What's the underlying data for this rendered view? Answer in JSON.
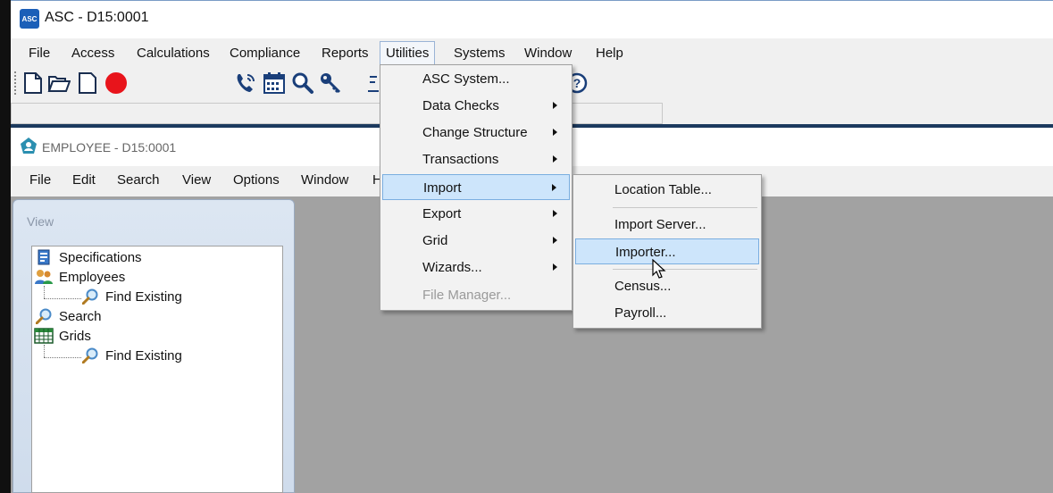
{
  "window": {
    "title": "ASC - D15:0001",
    "icon_text": "ASC"
  },
  "main_menu": [
    "File",
    "Access",
    "Calculations",
    "Compliance",
    "Reports",
    "Utilities",
    "Systems",
    "Window",
    "Help"
  ],
  "toolbar_icons": [
    "new-file-icon",
    "open-folder-icon",
    "blank-page-icon",
    "record-icon",
    "phone-icon",
    "calendar-icon",
    "search-icon",
    "key-icon",
    "help-icon"
  ],
  "child_window": {
    "title": "EMPLOYEE - D15:0001"
  },
  "child_menu": [
    "File",
    "Edit",
    "Search",
    "View",
    "Options",
    "Window",
    "H"
  ],
  "view_panel": {
    "label": "View",
    "tree": {
      "specifications": "Specifications",
      "employees": "Employees",
      "employees_find": "Find Existing",
      "search": "Search",
      "grids": "Grids",
      "grids_find": "Find Existing"
    }
  },
  "utilities_menu": [
    {
      "label": "ASC System...",
      "submenu": false
    },
    {
      "label": "Data Checks",
      "submenu": true
    },
    {
      "label": "Change Structure",
      "submenu": true
    },
    {
      "label": "Transactions",
      "submenu": true
    },
    {
      "label": "Import",
      "submenu": true
    },
    {
      "label": "Export",
      "submenu": true
    },
    {
      "label": "Grid",
      "submenu": true
    },
    {
      "label": "Wizards...",
      "submenu": true
    },
    {
      "label": "File Manager...",
      "submenu": false
    }
  ],
  "import_submenu": [
    "Location Table...",
    "Import Server...",
    "Importer...",
    "Census...",
    "Payroll..."
  ],
  "colors": {
    "highlight": "#cde5fb",
    "workspace": "#a2a2a2",
    "accent": "#1b5fb8"
  }
}
